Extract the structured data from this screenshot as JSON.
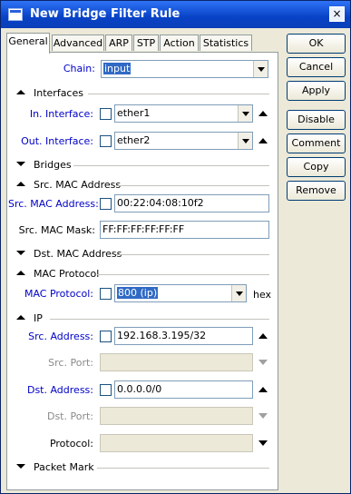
{
  "window": {
    "title": "New Bridge Filter Rule",
    "close_glyph": "×"
  },
  "tabs": [
    "General",
    "Advanced",
    "ARP",
    "STP",
    "Action",
    "Statistics"
  ],
  "active_tab": "General",
  "buttons": {
    "ok": "OK",
    "cancel": "Cancel",
    "apply": "Apply",
    "disable": "Disable",
    "comment": "Comment",
    "copy": "Copy",
    "remove": "Remove"
  },
  "form": {
    "chain": {
      "label": "Chain:",
      "value": "input"
    },
    "sections": {
      "interfaces": "Interfaces",
      "bridges": "Bridges",
      "src_mac": "Src. MAC Address",
      "dst_mac": "Dst. MAC Address",
      "mac_protocol": "MAC Protocol",
      "ip": "IP",
      "packet_mark": "Packet Mark"
    },
    "in_interface": {
      "label": "In. Interface:",
      "value": "ether1"
    },
    "out_interface": {
      "label": "Out. Interface:",
      "value": "ether2"
    },
    "src_mac_address": {
      "label": "Src. MAC Address:",
      "value": "00:22:04:08:10f2"
    },
    "src_mac_mask": {
      "label": "Src. MAC Mask:",
      "value": "FF:FF:FF:FF:FF:FF"
    },
    "mac_protocol": {
      "label": "MAC Protocol:",
      "value": "800 (ip)",
      "suffix": "hex"
    },
    "src_address": {
      "label": "Src. Address:",
      "value": "192.168.3.195/32"
    },
    "src_port": {
      "label": "Src. Port:",
      "value": ""
    },
    "dst_address": {
      "label": "Dst. Address:",
      "value": "0.0.0.0/0"
    },
    "dst_port": {
      "label": "Dst. Port:",
      "value": ""
    },
    "protocol": {
      "label": "Protocol:",
      "value": ""
    }
  },
  "colors": {
    "title_bar": "#0842c6",
    "blue_label": "#0000c8",
    "selection": "#316ac5"
  }
}
